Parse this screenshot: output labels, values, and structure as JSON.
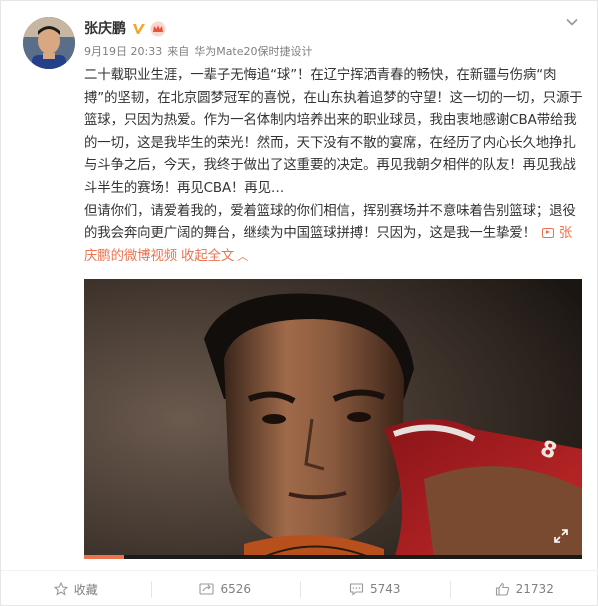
{
  "post": {
    "username": "张庆鹏",
    "date": "9月19日 20:33",
    "source_prefix": "来自",
    "source": "华为Mate20保时捷设计",
    "paragraphs": [
      "二十载职业生涯，一辈子无悔追“球”！在辽宁挥洒青春的畅快，在新疆与伤病“肉搏”的坚韧，在北京圆梦冠军的喜悦，在山东执着追梦的守望！这一切的一切，只源于篮球，只因为热爱。作为一名体制内培养出来的职业球员，我由衷地感谢CBA带给我的一切，这是我毕生的荣光！然而，天下没有不散的宴席，在经历了内心长久地挣扎与斗争之后，今天，我终于做出了这重要的决定。再见我朝夕相伴的队友！再见我战斗半生的赛场！再见CBA！再见…",
      "但请你们，请爱着我的，爱着篮球的你们相信，挥别赛场并不意味着告别篮球；退役的我会奔向更广阔的舞台，继续为中国篮球拼搏！只因为，这是我一生挚爱！"
    ],
    "video_link_label": "张庆鹏的微博视频",
    "collapse_label": "收起全文"
  },
  "video": {
    "progress": 0.08
  },
  "actions": {
    "favorite_label": "收藏",
    "repost_count": "6526",
    "comment_count": "5743",
    "like_count": "21732"
  },
  "colors": {
    "accent": "#eb7350",
    "verified": "#f6a42a",
    "text": "#333333",
    "muted": "#808080"
  },
  "icons": [
    "verified-icon",
    "crown-icon",
    "chevron-down-icon",
    "video-icon",
    "fullscreen-icon",
    "star-icon",
    "repost-icon",
    "comment-icon",
    "like-icon"
  ]
}
